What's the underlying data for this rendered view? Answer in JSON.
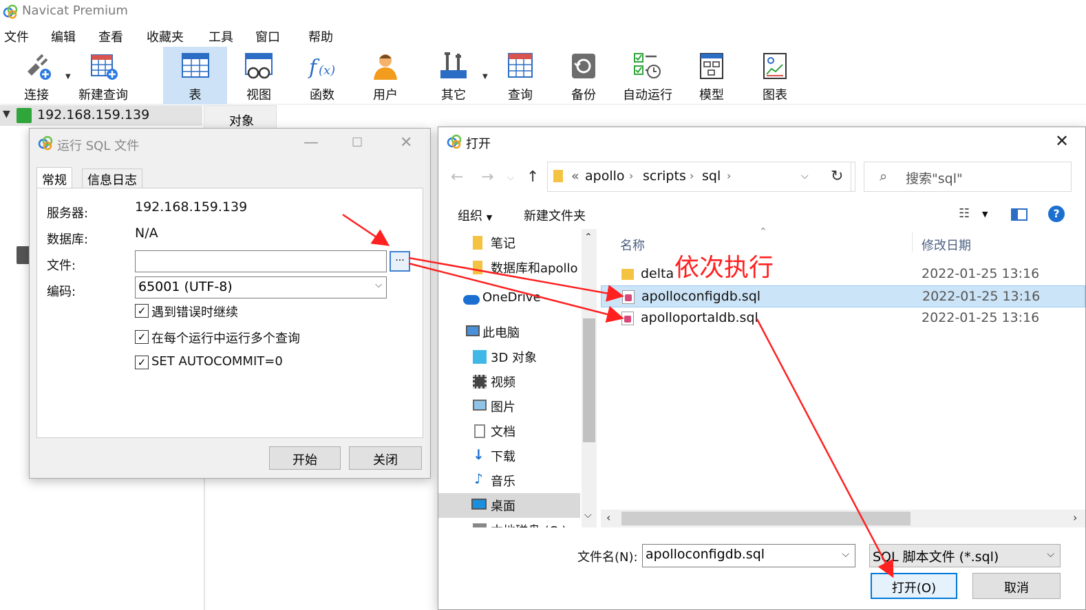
{
  "app": {
    "title": "Navicat Premium"
  },
  "menu": [
    "文件",
    "编辑",
    "查看",
    "收藏夹",
    "工具",
    "窗口",
    "帮助"
  ],
  "toolbar": {
    "items": [
      {
        "label": "连接",
        "icon": "connect-icon"
      },
      {
        "label": "新建查询",
        "icon": "new-query-icon"
      },
      {
        "label": "表",
        "icon": "table-icon",
        "active": true
      },
      {
        "label": "视图",
        "icon": "view-icon"
      },
      {
        "label": "函数",
        "icon": "function-icon"
      },
      {
        "label": "用户",
        "icon": "user-icon"
      },
      {
        "label": "其它",
        "icon": "tools-icon"
      },
      {
        "label": "查询",
        "icon": "query-icon"
      },
      {
        "label": "备份",
        "icon": "backup-icon"
      },
      {
        "label": "自动运行",
        "icon": "automation-icon"
      },
      {
        "label": "模型",
        "icon": "model-icon"
      },
      {
        "label": "图表",
        "icon": "chart-icon"
      }
    ]
  },
  "connection": {
    "host": "192.168.159.139"
  },
  "object_tab": "对象",
  "sql_dialog": {
    "title": "运行 SQL 文件",
    "tabs": [
      "常规",
      "信息日志"
    ],
    "server_label": "服务器:",
    "server_value": "192.168.159.139",
    "database_label": "数据库:",
    "database_value": "N/A",
    "file_label": "文件:",
    "file_value": "",
    "browse_label": "...",
    "encoding_label": "编码:",
    "encoding_value": "65001 (UTF-8)",
    "options": [
      {
        "label": "遇到错误时继续",
        "checked": true
      },
      {
        "label": "在每个运行中运行多个查询",
        "checked": true
      },
      {
        "label": "SET AUTOCOMMIT=0",
        "checked": true
      }
    ],
    "start_button": "开始",
    "close_button": "关闭"
  },
  "open_dialog": {
    "title": "打开",
    "path_prefix": "«",
    "path": [
      "apollo",
      "scripts",
      "sql"
    ],
    "search_placeholder": "搜索\"sql\"",
    "organize": "组织",
    "new_folder": "新建文件夹",
    "nav_items": [
      {
        "label": "笔记",
        "icon": "folder-icon"
      },
      {
        "label": "数据库和apollo",
        "icon": "folder-icon"
      },
      {
        "label": "OneDrive",
        "icon": "onedrive-icon"
      },
      {
        "label": "此电脑",
        "icon": "pc-icon"
      },
      {
        "label": "3D 对象",
        "icon": "3d-objects-icon"
      },
      {
        "label": "视频",
        "icon": "video-icon"
      },
      {
        "label": "图片",
        "icon": "pictures-icon"
      },
      {
        "label": "文档",
        "icon": "documents-icon"
      },
      {
        "label": "下载",
        "icon": "download-icon"
      },
      {
        "label": "音乐",
        "icon": "music-icon"
      },
      {
        "label": "桌面",
        "icon": "desktop-icon",
        "selected": true
      },
      {
        "label": "本地磁盘 (C:)",
        "icon": "disk-icon"
      }
    ],
    "columns": {
      "name": "名称",
      "modified": "修改日期"
    },
    "files": [
      {
        "name": "delta",
        "date": "2022-01-25 13:16",
        "type": "folder"
      },
      {
        "name": "apolloconfigdb.sql",
        "date": "2022-01-25 13:16",
        "type": "sql",
        "selected": true
      },
      {
        "name": "apolloportaldb.sql",
        "date": "2022-01-25 13:16",
        "type": "sql"
      }
    ],
    "filename_label": "文件名(N):",
    "filename_value": "apolloconfigdb.sql",
    "filetype_value": "SQL 脚本文件 (*.sql)",
    "open_button": "打开(O)",
    "cancel_button": "取消"
  },
  "annotation": {
    "text": "依次执行",
    "color": "#ff2020"
  }
}
